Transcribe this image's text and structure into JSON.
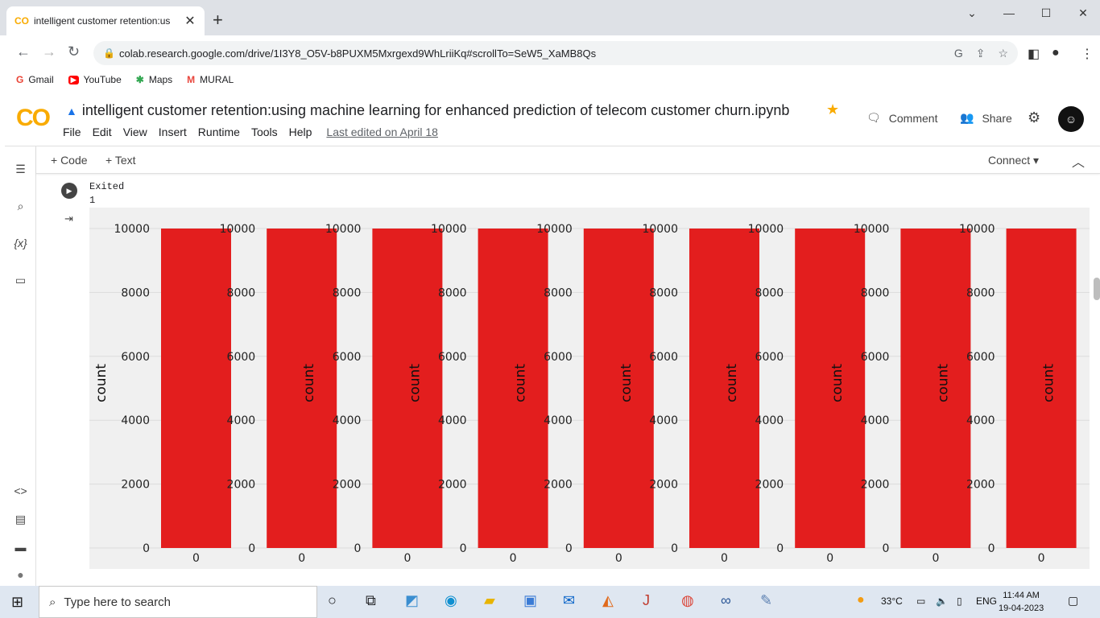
{
  "browser": {
    "tab_title": "intelligent customer retention:us",
    "tab_close": "✕",
    "new_tab": "+",
    "url": "colab.research.google.com/drive/1I3Y8_O5V-b8PUXM5Mxrgexd9WhLriiKq#scrollTo=SeW5_XaMB8Qs",
    "window_controls": {
      "minimize": "—",
      "restore": "☐",
      "close": "✕",
      "dropdown": "⌄"
    }
  },
  "bookmarks": [
    {
      "label": "Gmail",
      "icon": "G"
    },
    {
      "label": "YouTube",
      "icon": "▶"
    },
    {
      "label": "Maps",
      "icon": "✱"
    },
    {
      "label": "MURAL",
      "icon": "M"
    }
  ],
  "colab": {
    "logo": "CO",
    "notebook_title": "intelligent customer retention:using machine learning for enhanced prediction  of telecom customer churn.ipynb",
    "menu": [
      "File",
      "Edit",
      "View",
      "Insert",
      "Runtime",
      "Tools",
      "Help"
    ],
    "last_edited": "Last edited on April 18",
    "comment_label": "Comment",
    "share_label": "Share",
    "add_code": "+ Code",
    "add_text": "+ Text",
    "connect_label": "Connect"
  },
  "output": {
    "line1": "Exited",
    "line2": "1"
  },
  "chart_data": {
    "type": "bar",
    "panels": 9,
    "ylabel": "count",
    "yticks": [
      0,
      2000,
      4000,
      6000,
      8000,
      10000
    ],
    "categories": [
      "0"
    ],
    "values": [
      10000
    ],
    "ylim": [
      0,
      10000
    ],
    "bar_color": "#e31e1e",
    "background": "#f0f0f0"
  },
  "taskbar": {
    "search_placeholder": "Type here to search",
    "weather": "33°C",
    "language": "ENG",
    "time": "11:44 AM",
    "date": "19-04-2023"
  }
}
